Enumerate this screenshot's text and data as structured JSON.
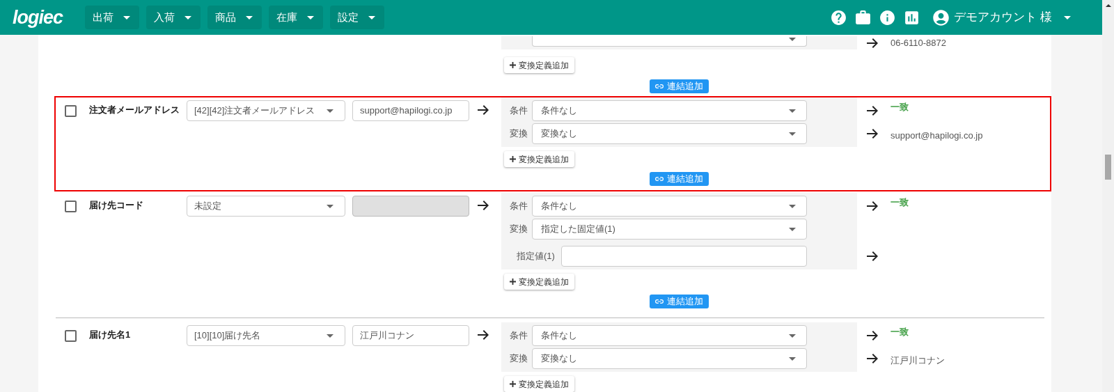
{
  "header": {
    "logo": "logiec",
    "menus": [
      {
        "label": "出荷"
      },
      {
        "label": "入荷"
      },
      {
        "label": "商品"
      },
      {
        "label": "在庫"
      },
      {
        "label": "設定"
      }
    ],
    "account": "デモアカウント 様"
  },
  "rows": [
    {
      "kind": "continued",
      "highlighted": false,
      "divider_above": false,
      "rules": [
        {
          "kind": "select",
          "arrow": true,
          "result": "06-6110-8872",
          "match": false
        }
      ],
      "add_button": "変換定義追加",
      "link_button": "連結追加"
    },
    {
      "kind": "field",
      "highlighted": true,
      "divider_above": false,
      "checked": false,
      "name": "注文者メールアドレス",
      "source": "[42][42]注文者メールアドレス",
      "sample": "support@hapilogi.co.jp",
      "sample_disabled": false,
      "rules": [
        {
          "kind": "select",
          "label": "条件",
          "value": "条件なし",
          "arrow": true,
          "result": "一致",
          "match": true
        },
        {
          "kind": "select",
          "label": "変換",
          "value": "変換なし",
          "arrow": true,
          "result": "support@hapilogi.co.jp",
          "match": false
        }
      ],
      "add_button": "変換定義追加",
      "link_button": "連結追加"
    },
    {
      "kind": "field",
      "highlighted": false,
      "divider_above": false,
      "checked": false,
      "name": "届け先コード",
      "source": "未設定",
      "sample_disabled": true,
      "rules": [
        {
          "kind": "select",
          "label": "条件",
          "value": "条件なし",
          "arrow": true,
          "result": "一致",
          "match": true
        },
        {
          "kind": "select",
          "label": "変換",
          "value": "指定した固定値(1)",
          "arrow": false
        },
        {
          "kind": "input",
          "label": "指定値(1)",
          "arrow": true
        }
      ],
      "add_button": "変換定義追加",
      "link_button": "連結追加"
    },
    {
      "kind": "field",
      "highlighted": false,
      "divider_above": true,
      "checked": false,
      "name": "届け先名1",
      "source": "[10][10]届け先名",
      "sample": "江戸川コナン",
      "sample_disabled": false,
      "rules": [
        {
          "kind": "select",
          "label": "条件",
          "value": "条件なし",
          "arrow": true,
          "result": "一致",
          "match": true
        },
        {
          "kind": "select",
          "label": "変換",
          "value": "変換なし",
          "arrow": true,
          "result": "江戸川コナン",
          "match": false
        }
      ],
      "add_button": "変換定義追加"
    }
  ]
}
